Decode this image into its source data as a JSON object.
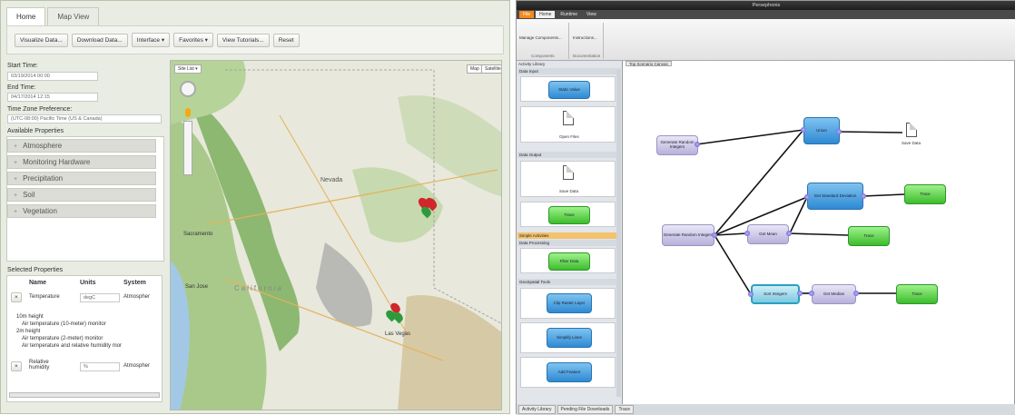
{
  "left_app": {
    "tabs": [
      "Home",
      "Map View"
    ],
    "toolbar": [
      "Visualize Data...",
      "Download Data...",
      "Interface ▾",
      "Favorites ▾",
      "View Tutorials...",
      "Reset"
    ],
    "start_time_label": "Start Time:",
    "start_time_value": "03/19/2014 00:00",
    "end_time_label": "End Time:",
    "end_time_value": "04/17/2014 12:15",
    "tz_label": "Time Zone Preference:",
    "tz_value": "(UTC-08:00) Pacific Time (US & Canada)",
    "available_label": "Available Properties",
    "available_properties": [
      "Atmosphere",
      "Monitoring Hardware",
      "Precipitation",
      "Soil",
      "Vegetation"
    ],
    "selected_label": "Selected Properties",
    "selected_headers": [
      "Name",
      "Units",
      "System"
    ],
    "row1": {
      "name": "Temperature",
      "units": "degC",
      "system": "Atmospher"
    },
    "tenm": "10m height",
    "tenm_item": "Air temperature (10-meter) monitor",
    "twom": "2m height",
    "twom_item1": "Air temperature (2-meter) monitor",
    "twom_item2": "Air temperature and relative humidity mor",
    "row2": {
      "name": "Relative humidity",
      "units": "%",
      "system": "Atmospher"
    },
    "map": {
      "site_list": "Site List ▾",
      "map_btn": "Map",
      "sat_btn": "Satellite",
      "labels": {
        "nevada": "Nevada",
        "sacramento": "Sacramento",
        "california": "California",
        "san_jose": "San Jose",
        "las_vegas": "Las Vegas"
      }
    }
  },
  "right_app": {
    "title": "Persephonis",
    "ribbon_tabs": [
      "File",
      "Home",
      "Runtime",
      "View"
    ],
    "ribbon_buttons": [
      "Manage Components...",
      "Instructions..."
    ],
    "ribbon_groups": [
      "Components",
      "Documentation"
    ],
    "library_title": "Activity Library",
    "canvas_tab": "Top Scenario Canvas",
    "sections": {
      "data_input": "Data Input",
      "data_output": "Data Output",
      "simple": "Simple Activities",
      "processing": "Data Processing",
      "geospatial": "GeoSpatial Tools"
    },
    "lib_items": {
      "static_value": "Static Value",
      "open_files": "Open Files",
      "save_data": "Save Data",
      "trace": "Trace",
      "filter_data": "Filter Data",
      "clip_raster": "Clip Raster Layer",
      "simplify_lines": "Simplify Lines",
      "add_feature": "Add Feature"
    },
    "nodes": {
      "gen1": "Generate Random Integers",
      "gen2": "Generate Random Integers",
      "union": "Union",
      "save": "Save Data",
      "stddev": "Get Standard Deviation",
      "trace1": "Trace",
      "mean": "Get Mean",
      "trace2": "Trace",
      "sort": "Sort Integers",
      "median": "Get Median",
      "trace3": "Trace"
    },
    "bottom_tabs": [
      "Activity Library",
      "Pending File Downloads",
      "Trace"
    ]
  }
}
